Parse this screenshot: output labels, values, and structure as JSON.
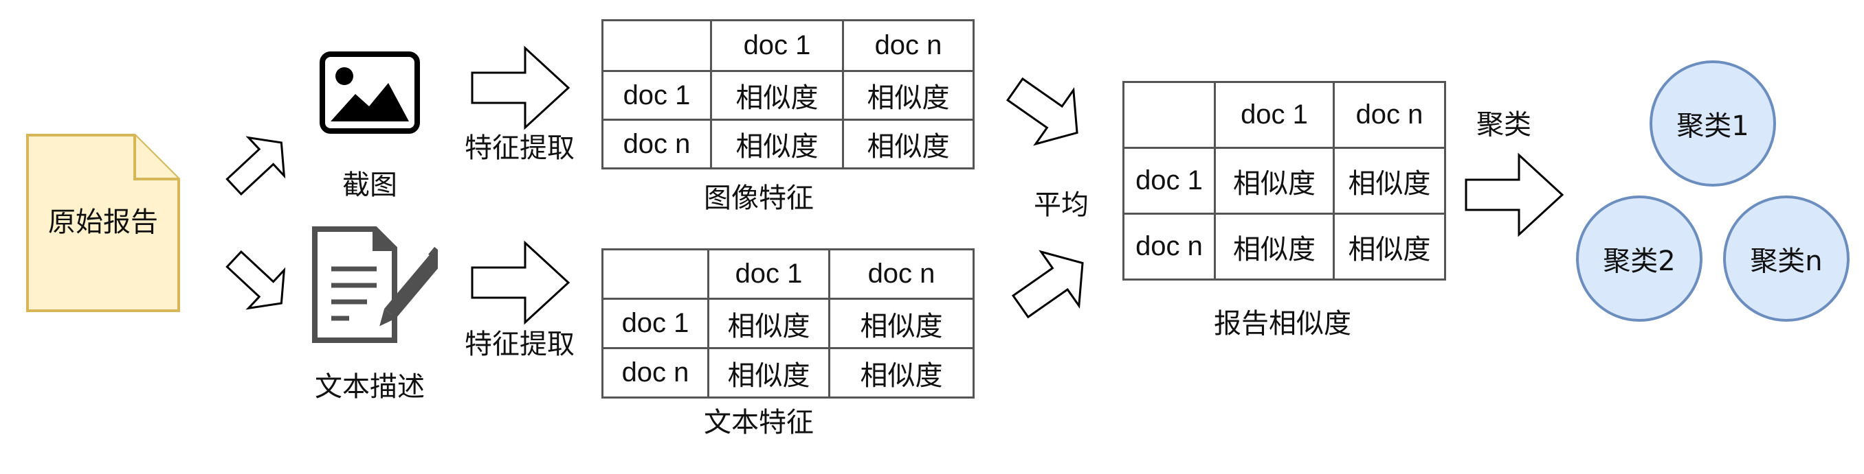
{
  "source": {
    "label": "原始报告",
    "fill": "#fff2cc",
    "stroke": "#d6b656"
  },
  "screenshot": {
    "label": "截图"
  },
  "text_desc": {
    "label": "文本描述"
  },
  "extract_top": {
    "label": "特征提取"
  },
  "extract_bottom": {
    "label": "特征提取"
  },
  "image_features": {
    "caption": "图像特征",
    "header": [
      "",
      "doc 1",
      "doc n"
    ],
    "rows": [
      [
        "doc 1",
        "相似度",
        "相似度"
      ],
      [
        "doc n",
        "相似度",
        "相似度"
      ]
    ]
  },
  "text_features": {
    "caption": "文本特征",
    "header": [
      "",
      "doc 1",
      "doc n"
    ],
    "rows": [
      [
        "doc 1",
        "相似度",
        "相似度"
      ],
      [
        "doc n",
        "相似度",
        "相似度"
      ]
    ]
  },
  "average": {
    "label": "平均"
  },
  "report_similarity": {
    "caption": "报告相似度",
    "header": [
      "",
      "doc 1",
      "doc n"
    ],
    "rows": [
      [
        "doc 1",
        "相似度",
        "相似度"
      ],
      [
        "doc n",
        "相似度",
        "相似度"
      ]
    ]
  },
  "cluster_step": {
    "label": "聚类"
  },
  "clusters": [
    {
      "label": "聚类1"
    },
    {
      "label": "聚类2"
    },
    {
      "label": "聚类n"
    }
  ],
  "colors": {
    "cluster_fill": "#dae8fc",
    "cluster_stroke": "#6c8ebf",
    "arrow_stroke": "#000000",
    "table_border": "#555555"
  },
  "icons": {
    "screenshot": "image-icon",
    "text_desc": "document-pen-icon"
  }
}
